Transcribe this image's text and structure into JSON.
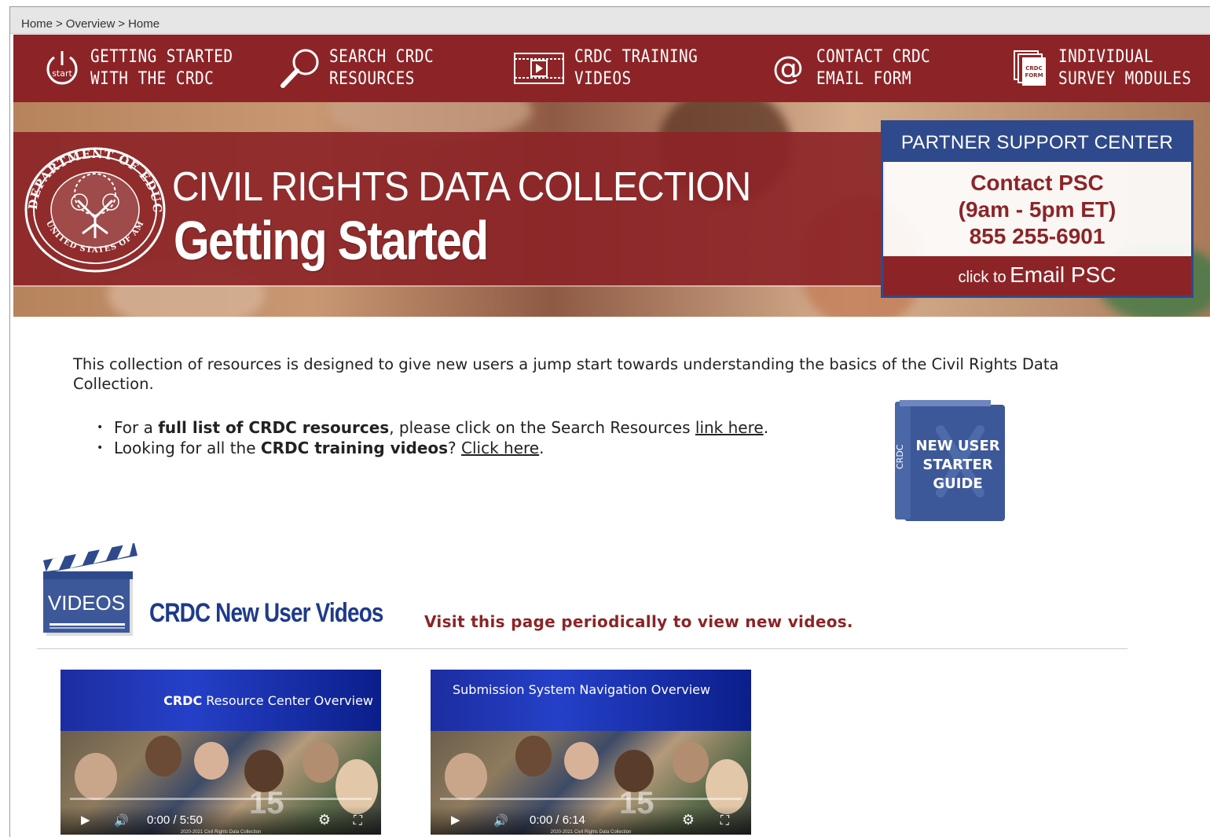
{
  "breadcrumb": {
    "items": [
      "Home",
      "Overview",
      "Home"
    ],
    "sep": ">"
  },
  "nav": {
    "items": [
      {
        "line1": "GETTING STARTED",
        "line2": "WITH THE CRDC",
        "icon": "start-power-icon",
        "icon_text": "start"
      },
      {
        "line1": "SEARCH CRDC",
        "line2": "RESOURCES",
        "icon": "magnifier-icon"
      },
      {
        "line1": "CRDC TRAINING",
        "line2": "VIDEOS",
        "icon": "film-strip-icon"
      },
      {
        "line1": "CONTACT CRDC",
        "line2": "EMAIL FORM",
        "icon": "at-sign-icon",
        "icon_text": "@"
      },
      {
        "line1": "INDIVIDUAL",
        "line2": "SURVEY MODULES",
        "icon": "documents-icon",
        "icon_text": "CRDC FORM"
      }
    ]
  },
  "hero": {
    "title": "CIVIL RIGHTS DATA COLLECTION",
    "subtitle": "Getting Started",
    "seal_text_top": "DEPARTMENT OF EDUCATION",
    "seal_text_bottom": "UNITED STATES OF AMERICA"
  },
  "psc": {
    "header": "PARTNER SUPPORT CENTER",
    "line1": "Contact PSC",
    "line2": "(9am - 5pm ET)",
    "line3": "855 255-6901",
    "email_small": "click to",
    "email_big": "Email PSC"
  },
  "intro": "This collection of resources is designed to give new users a jump start towards understanding the basics of the Civil Rights Data Collection.",
  "bullets": {
    "b1_pre": "For a ",
    "b1_bold": "full list of CRDC resources",
    "b1_mid": ", please click on the Search Resources ",
    "b1_link": "link here",
    "b1_end": ".",
    "b2_pre": "Looking for all the ",
    "b2_bold": "CRDC training videos",
    "b2_mid": "? ",
    "b2_link": "Click here",
    "b2_end": "."
  },
  "guide": {
    "spine": "CRDC",
    "line1": "NEW USER",
    "line2": "STARTER",
    "line3": "GUIDE"
  },
  "videos_section": {
    "icon_label": "VIDEOS",
    "title": "CRDC New User Videos",
    "note": "Visit this page periodically to view new videos."
  },
  "videos": [
    {
      "title_bold": "CRDC",
      "title_rest": " Resource Center Overview",
      "time": "0:00 / 5:50",
      "caption": "2020-2021 Civil Rights Data Collection",
      "badge": "15"
    },
    {
      "title_bold": "",
      "title_rest": "Submission System Navigation Overview",
      "time": "0:00 / 6:14",
      "caption": "2020-2021 Civil Rights Data Collection",
      "badge": "15"
    }
  ],
  "colors": {
    "brand_red": "#8c2427",
    "brand_blue": "#2f4a8c",
    "title_blue": "#1f3a8a"
  }
}
